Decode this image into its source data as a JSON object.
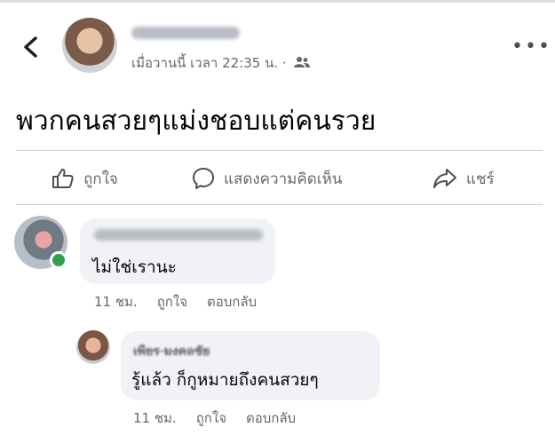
{
  "post": {
    "author_name": "",
    "timestamp": "เมื่อวานนี้ เวลา 22:35 น.",
    "separator": "·",
    "audience_icon": "friends-icon",
    "text": "พวกคนสวยๆแม่งชอบแต่คนรวย"
  },
  "actions": {
    "like": "ถูกใจ",
    "comment": "แสดงความคิดเห็น",
    "share": "แชร์"
  },
  "comments": [
    {
      "author": "",
      "text": "ไม่ใช่เรานะ",
      "time": "11 ชม.",
      "like": "ถูกใจ",
      "reply": "ตอบกลับ",
      "online": true
    },
    {
      "author": "เพียร มงคลชัย",
      "text": "รู้แล้ว ก็กูหมายถึงคนสวยๆ",
      "time": "11 ชม.",
      "like": "ถูกใจ",
      "reply": "ตอบกลับ",
      "online": false
    }
  ],
  "colors": {
    "online": "#31a24c",
    "bubble": "#f0f2f5",
    "secondary_text": "#65676b"
  }
}
